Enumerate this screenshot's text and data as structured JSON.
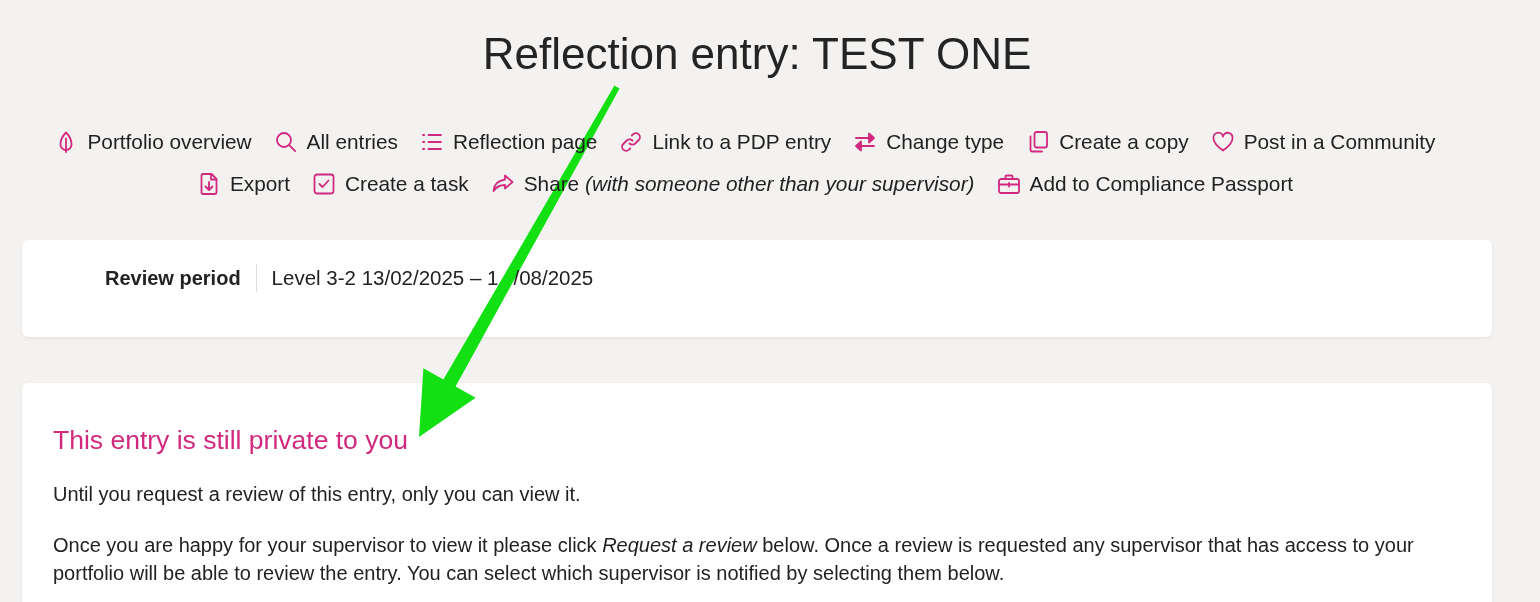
{
  "title": "Reflection entry: TEST ONE",
  "actions": [
    {
      "kind": "overview",
      "label": "Portfolio overview"
    },
    {
      "kind": "entries",
      "label": "All entries"
    },
    {
      "kind": "page",
      "label": "Reflection page"
    },
    {
      "kind": "link",
      "label": "Link to a PDP entry"
    },
    {
      "kind": "type",
      "label": "Change type"
    },
    {
      "kind": "copy",
      "label": "Create a copy"
    },
    {
      "kind": "community",
      "label": "Post in a Community"
    },
    {
      "kind": "export",
      "label": "Export"
    },
    {
      "kind": "task",
      "label": "Create a task"
    },
    {
      "kind": "share",
      "label": "Share *(with someone other than your supervisor)*"
    },
    {
      "kind": "passport",
      "label": "Add to Compliance Passport"
    }
  ],
  "review_period": {
    "label": "Review period",
    "value_parts": [
      "Level 3-2 13/02/2025 – 1",
      "/08/2025"
    ]
  },
  "privacy_notice": {
    "heading": "This entry is still private to you",
    "paragraphs": [
      "Until you request a review of this entry, only you can view it.",
      "Once you are happy for your supervisor to view it please click *Request a review* below. Once a review is requested any supervisor that has access to your portfolio will be able to review the entry. You can select which supervisor is notified by selecting them below."
    ]
  }
}
